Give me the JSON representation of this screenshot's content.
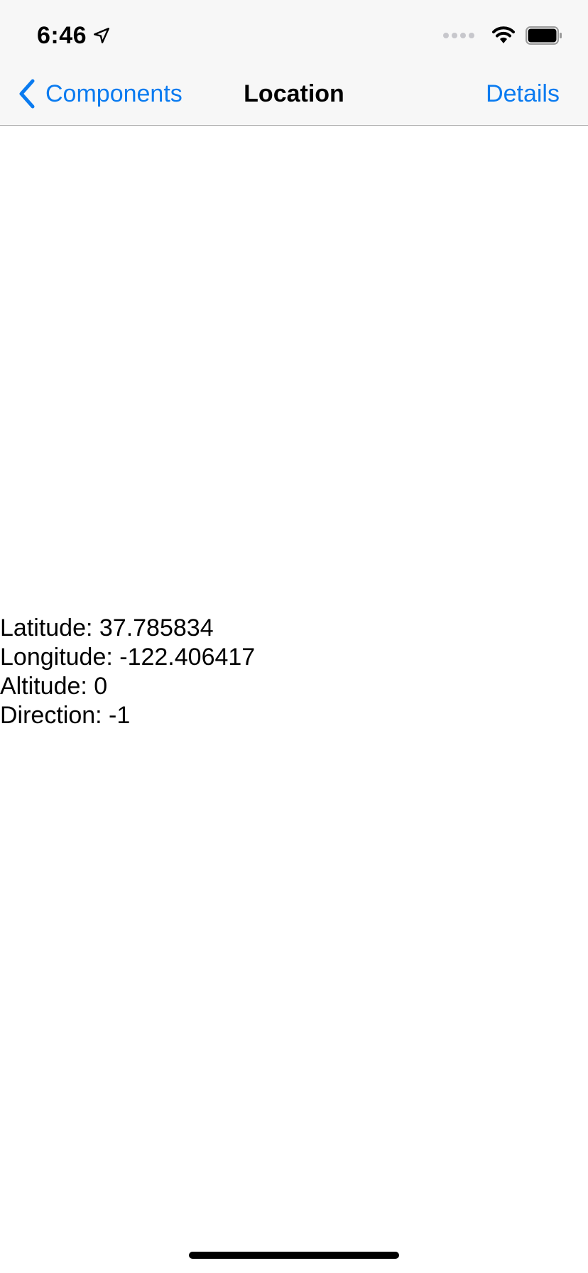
{
  "status_bar": {
    "time": "6:46",
    "icons": [
      "location-arrow-icon",
      "cellular-signal-icon",
      "wifi-icon",
      "battery-icon"
    ]
  },
  "nav_bar": {
    "back_label": "Components",
    "title": "Location",
    "right_button_label": "Details"
  },
  "location": {
    "latitude": "Latitude: 37.785834",
    "longitude": "Longitude: -122.406417",
    "altitude": "Altitude: 0",
    "direction": "Direction: -1"
  },
  "colors": {
    "accent": "#0a7bf0",
    "nav_background": "#f7f7f7",
    "text": "#000000"
  }
}
